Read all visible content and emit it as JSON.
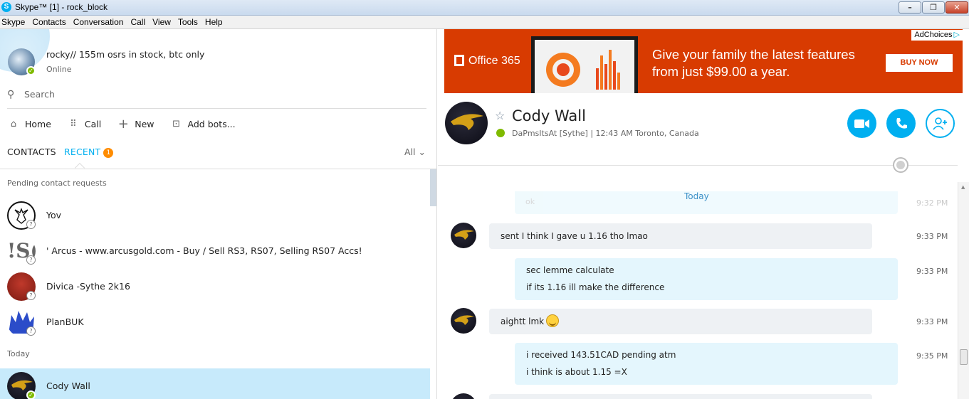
{
  "window": {
    "title": "Skype™ [1] - rock_block",
    "app_icon": "S"
  },
  "menu": [
    "Skype",
    "Contacts",
    "Conversation",
    "Call",
    "View",
    "Tools",
    "Help"
  ],
  "profile": {
    "mood": "rocky// 155m osrs in stock, btc only",
    "status": "Online"
  },
  "search": {
    "placeholder": "Search"
  },
  "nav": {
    "home": "Home",
    "call": "Call",
    "new": "New",
    "bots": "Add bots..."
  },
  "tabs": {
    "contacts": "CONTACTS",
    "recent": "RECENT",
    "recent_badge": "1",
    "filter": "All"
  },
  "sections": {
    "pending": "Pending contact requests",
    "today": "Today"
  },
  "pending_contacts": [
    {
      "name": "Yov"
    },
    {
      "name": "' Arcus - www.arcusgold.com - Buy / Sell RS3, RS07, Selling RS07 Accs!"
    },
    {
      "name": "Divica -Sythe 2k16"
    },
    {
      "name": "PlanBUK"
    }
  ],
  "today_contacts": [
    {
      "name": "Cody Wall"
    }
  ],
  "ad": {
    "adchoices": "AdChoices",
    "brand": "Office 365",
    "headline": "Give your family the latest features from just $99.00 a year.",
    "cta": "BUY NOW",
    "color": "#d83b01"
  },
  "conversation": {
    "name": "Cody Wall",
    "subtitle": "DaPmsItsAt [Sythe]  |  12:43 AM Toronto, Canada",
    "day_label": "Today",
    "faded_message": "ok",
    "faded_time": "9:32 PM",
    "messages": [
      {
        "direction": "in",
        "lines": [
          "sent I think I gave u 1.16 tho lmao"
        ],
        "time": "9:33 PM"
      },
      {
        "direction": "out",
        "lines": [
          "sec lemme calculate",
          "if its 1.16 ill make the difference"
        ],
        "time": "9:33 PM"
      },
      {
        "direction": "in",
        "lines": [
          "aightt lmk"
        ],
        "emoji": "grin-emoji",
        "time": "9:33 PM"
      },
      {
        "direction": "out",
        "lines": [
          "i received 143.51CAD pending atm",
          "i think is about 1.15 =X"
        ],
        "time": "9:35 PM"
      }
    ]
  },
  "colors": {
    "accent": "#00aff0",
    "online": "#7fba00",
    "badge": "#ff8c00",
    "selected_row": "#c7eafb"
  }
}
